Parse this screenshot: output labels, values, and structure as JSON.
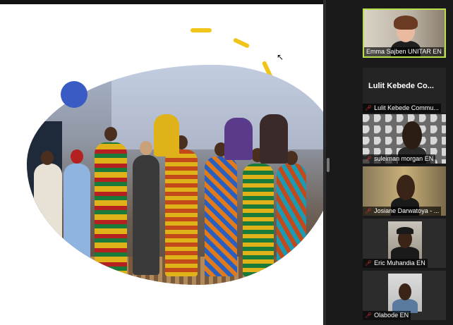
{
  "participants": [
    {
      "name": "Emma Sajben UNITAR EN",
      "active": true
    },
    {
      "name": "Lulit Kebede Co...",
      "name_label": "Lulit Kebede Commu...",
      "muted": true
    },
    {
      "name": "suleiman morgan EN",
      "muted": true
    },
    {
      "name": "Josiane Darwatoya - ...",
      "muted": true
    },
    {
      "name": "Eric Muhandia EN",
      "muted": true
    },
    {
      "name": "Olabode EN",
      "muted": true
    }
  ],
  "colors": {
    "accent_yellow": "#f0c419",
    "accent_blue": "#3b5bc4",
    "active_border": "#b8e04a",
    "mute_red": "#e53935"
  },
  "icons": {
    "mute": "muted-mic-icon",
    "cursor": "mouse-cursor-icon"
  }
}
